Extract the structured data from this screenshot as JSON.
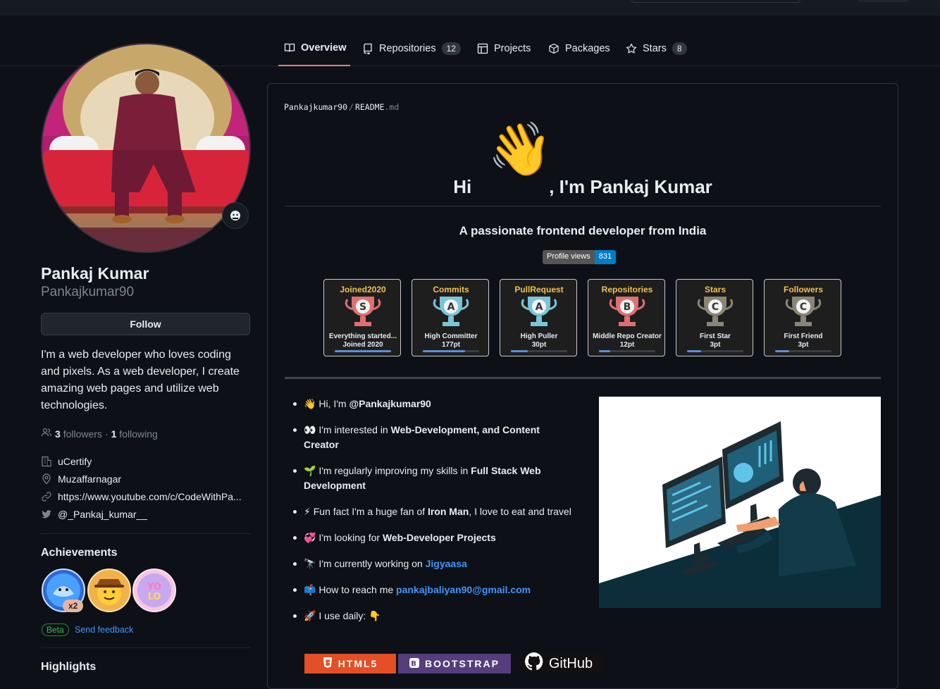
{
  "nav": {
    "tabs": [
      {
        "label": "Overview",
        "icon": "book-icon",
        "count": null,
        "active": true
      },
      {
        "label": "Repositories",
        "icon": "repo-icon",
        "count": "12"
      },
      {
        "label": "Projects",
        "icon": "table-icon",
        "count": null
      },
      {
        "label": "Packages",
        "icon": "package-icon",
        "count": null
      },
      {
        "label": "Stars",
        "icon": "star-icon",
        "count": "8"
      }
    ]
  },
  "profile": {
    "name": "Pankaj Kumar",
    "username": "Pankajkumar90",
    "follow_label": "Follow",
    "bio": "I'm a web developer who loves coding and pixels. As a web developer, I create amazing web pages and utilize web technologies.",
    "followers_count": "3",
    "followers_label": "followers",
    "dot": "·",
    "following_count": "1",
    "following_label": "following",
    "company": "uCertify",
    "location": "Muzaffarnagar",
    "website": "https://www.youtube.com/c/CodeWithPa...",
    "twitter": "@_Pankaj_kumar__"
  },
  "achievements": {
    "title": "Achievements",
    "multiplier": "x2",
    "beta_label": "Beta",
    "feedback_label": "Send feedback"
  },
  "highlights": {
    "title": "Highlights"
  },
  "readme": {
    "owner": "Pankajkumar90",
    "sep": "/",
    "file": "README",
    "ext": ".md",
    "hi": "Hi",
    "greeting": ", I'm Pankaj Kumar",
    "wave": "👋",
    "tagline": "A passionate frontend developer from India",
    "views_label": "Profile views",
    "views_count": "831",
    "trophies": [
      {
        "title": "Joined2020",
        "rank": "S",
        "line1": "Everything started...",
        "line2": "Joined 2020",
        "progress": 1.0,
        "color": "#e07070"
      },
      {
        "title": "Commits",
        "rank": "A",
        "line1": "High Committer",
        "line2": "177pt",
        "progress": 0.75,
        "color": "#7ac6d8"
      },
      {
        "title": "PullRequest",
        "rank": "A",
        "line1": "High Puller",
        "line2": "30pt",
        "progress": 0.3,
        "color": "#7ac6d8"
      },
      {
        "title": "Repositories",
        "rank": "B",
        "line1": "Middle Repo Creator",
        "line2": "12pt",
        "progress": 0.2,
        "color": "#e07070"
      },
      {
        "title": "Stars",
        "rank": "C",
        "line1": "First Star",
        "line2": "3pt",
        "progress": 0.25,
        "color": "#8a8675"
      },
      {
        "title": "Followers",
        "rank": "C",
        "line1": "First Friend",
        "line2": "3pt",
        "progress": 0.25,
        "color": "#8a8675"
      }
    ],
    "about": {
      "i1_emoji": "👋",
      "i1_text": " Hi, I'm ",
      "i1_bold": "@Pankajkumar90",
      "i2_emoji": "👀",
      "i2_text": " I'm interested in ",
      "i2_bold": "Web-Development, and Content Creator",
      "i3_emoji": "🌱",
      "i3_text": " I'm regularly improving my skills in ",
      "i3_bold": "Full Stack Web Development",
      "i4_emoji": "⚡",
      "i4_text": " Fun fact I'm a huge fan of ",
      "i4_bold": "Iron Man",
      "i4_tail": ", I love to eat and travel",
      "i5_emoji": "💞️",
      "i5_text": " I'm looking for ",
      "i5_bold": "Web-Developer Projects",
      "i6_emoji": "🔭",
      "i6_text": " I'm currently working on ",
      "i6_link": "Jigyaasa",
      "i7_emoji": "📫",
      "i7_text": " How to reach me ",
      "i7_link": "pankajbaliyan90@gmail.com",
      "i8_emoji": "🚀",
      "i8_text": " I use daily: ",
      "i8_tail": "👇"
    },
    "skills": [
      {
        "label": "HTML5",
        "color": "#e34f26"
      },
      {
        "label": "BOOTSTRAP",
        "color": "#563d7c"
      },
      {
        "label": "GitHub",
        "color": "#121011"
      }
    ]
  }
}
